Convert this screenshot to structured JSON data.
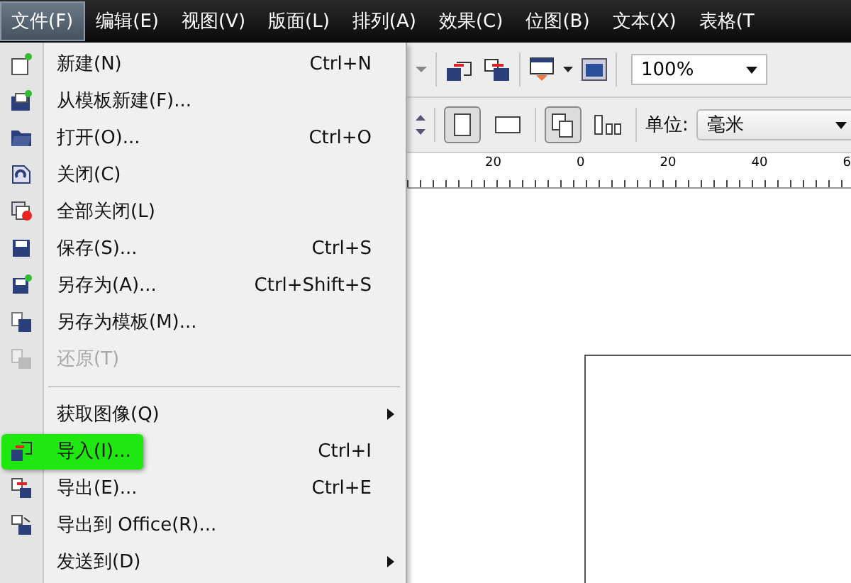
{
  "menu_bar": [
    {
      "label": "文件(F)",
      "selected": true
    },
    {
      "label": "编辑(E)",
      "selected": false
    },
    {
      "label": "视图(V)",
      "selected": false
    },
    {
      "label": "版面(L)",
      "selected": false
    },
    {
      "label": "排列(A)",
      "selected": false
    },
    {
      "label": "效果(C)",
      "selected": false
    },
    {
      "label": "位图(B)",
      "selected": false
    },
    {
      "label": "文本(X)",
      "selected": false
    },
    {
      "label": "表格(T",
      "selected": false
    }
  ],
  "file_menu": [
    {
      "kind": "item",
      "label": "新建(N)",
      "shortcut": "Ctrl+N",
      "disabled": false,
      "selected": false,
      "submenu": false
    },
    {
      "kind": "item",
      "label": "从模板新建(F)...",
      "disabled": false,
      "selected": false,
      "submenu": false
    },
    {
      "kind": "item",
      "label": "打开(O)...",
      "shortcut": "Ctrl+O",
      "disabled": false,
      "selected": false,
      "submenu": false
    },
    {
      "kind": "item",
      "label": "关闭(C)",
      "disabled": false,
      "selected": false,
      "submenu": false
    },
    {
      "kind": "item",
      "label": "全部关闭(L)",
      "disabled": false,
      "selected": false,
      "submenu": false
    },
    {
      "kind": "item",
      "label": "保存(S)...",
      "shortcut": "Ctrl+S",
      "disabled": false,
      "selected": false,
      "submenu": false
    },
    {
      "kind": "item",
      "label": "另存为(A)...",
      "shortcut": "Ctrl+Shift+S",
      "disabled": false,
      "selected": false,
      "submenu": false
    },
    {
      "kind": "item",
      "label": "另存为模板(M)...",
      "disabled": false,
      "selected": false,
      "submenu": false
    },
    {
      "kind": "item",
      "label": "还原(T)",
      "disabled": true,
      "selected": false,
      "submenu": false
    },
    {
      "kind": "separator"
    },
    {
      "kind": "item",
      "label": "获取图像(Q)",
      "disabled": false,
      "selected": false,
      "submenu": true
    },
    {
      "kind": "item",
      "label": "导入(I)...",
      "shortcut": "Ctrl+I",
      "disabled": false,
      "selected": true,
      "submenu": false
    },
    {
      "kind": "item",
      "label": "导出(E)...",
      "shortcut": "Ctrl+E",
      "disabled": false,
      "selected": false,
      "submenu": false
    },
    {
      "kind": "item",
      "label": "导出到 Office(R)...",
      "disabled": false,
      "selected": false,
      "submenu": false
    },
    {
      "kind": "item",
      "label": "发送到(D)",
      "disabled": false,
      "selected": false,
      "submenu": true
    }
  ],
  "toolbar": {
    "zoom": "100%"
  },
  "property_bar": {
    "portrait_selected": true,
    "all_pages_selected": true,
    "units_label": "单位:",
    "units": "毫米"
  },
  "ruler": [
    "20",
    "0",
    "20",
    "40",
    "6"
  ]
}
